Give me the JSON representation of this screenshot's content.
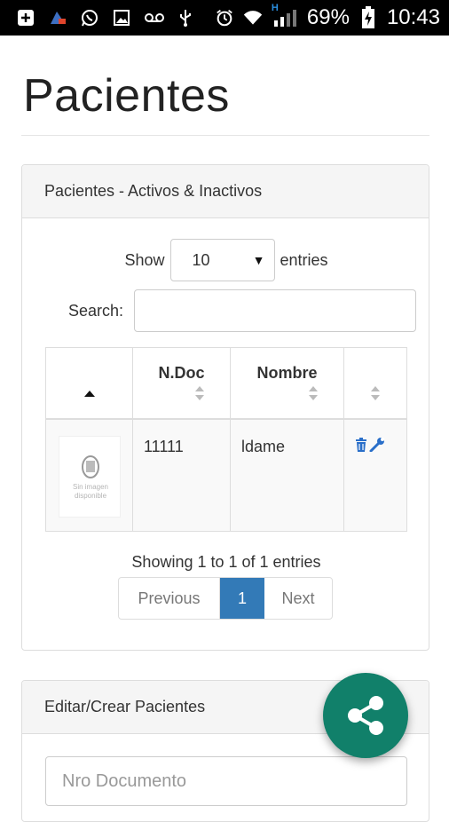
{
  "statusbar": {
    "battery_pct": "69%",
    "time": "10:43",
    "network_type": "H"
  },
  "page": {
    "title": "Pacientes"
  },
  "panel_list": {
    "heading": "Pacientes - Activos & Inactivos",
    "show_label": "Show",
    "entries_label": "entries",
    "page_size": "10",
    "search_label": "Search:",
    "search_value": "",
    "columns": [
      "",
      "N.Doc",
      "Nombre",
      ""
    ],
    "rows": [
      {
        "ndoc": "11111",
        "nombre": "ldame",
        "thumb_caption": "Sin imagen disponible"
      }
    ],
    "info": "Showing 1 to 1 of 1 entries",
    "pagination": {
      "previous": "Previous",
      "current": "1",
      "next": "Next"
    }
  },
  "panel_edit": {
    "heading": "Editar/Crear Pacientes",
    "nro_documento_placeholder": "Nro Documento"
  },
  "colors": {
    "primary": "#337ab7",
    "fab": "#11806a",
    "action_icons": "#2a6fc9"
  },
  "icons": [
    "share-icon",
    "delete-icon",
    "wrench-icon",
    "sort-icon",
    "wifi-icon",
    "alarm-icon"
  ]
}
